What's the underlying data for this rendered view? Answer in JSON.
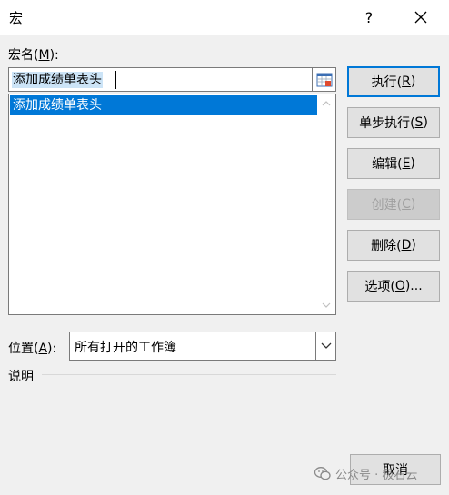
{
  "window": {
    "title": "宏",
    "help_label": "?",
    "close_icon": "close-icon"
  },
  "macro_name": {
    "label_prefix": "宏名(",
    "label_key": "M",
    "label_suffix": "):",
    "value": "添加成绩单表头",
    "picker_icon": "range-select-icon"
  },
  "macro_list": {
    "items": [
      "添加成绩单表头"
    ],
    "selected_index": 0
  },
  "buttons": {
    "run": {
      "text": "执行(",
      "key": "R",
      "suffix": ")"
    },
    "step_into": {
      "text": "单步执行(",
      "key": "S",
      "suffix": ")"
    },
    "edit": {
      "text": "编辑(",
      "key": "E",
      "suffix": ")"
    },
    "create": {
      "text": "创建(",
      "key": "C",
      "suffix": ")"
    },
    "delete": {
      "text": "删除(",
      "key": "D",
      "suffix": ")"
    },
    "options": {
      "text": "选项(",
      "key": "O",
      "suffix": ")..."
    },
    "cancel": {
      "text": "取消"
    }
  },
  "location": {
    "label_prefix": "位置(",
    "label_key": "A",
    "label_suffix": "):",
    "value": "所有打开的工作簿"
  },
  "description": {
    "label": "说明"
  },
  "watermark": {
    "text": "公众号 · 极石云"
  },
  "colors": {
    "accent": "#0078d7",
    "selection": "#0078d7",
    "input_highlight": "#cce4f7",
    "background": "#f0f0f0"
  }
}
